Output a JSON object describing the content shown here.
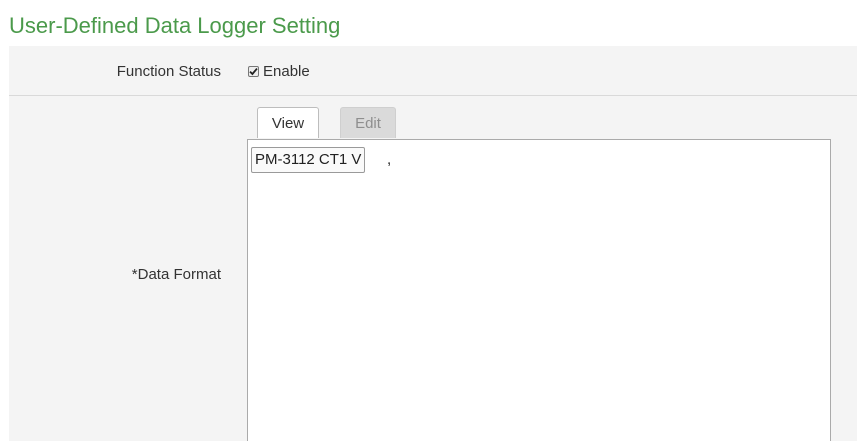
{
  "page": {
    "title": "User-Defined Data Logger Setting"
  },
  "function_status": {
    "label": "Function Status",
    "checkbox_label": "Enable",
    "checked": true
  },
  "data_format": {
    "label": "*Data Format",
    "tabs": [
      {
        "label": "View",
        "active": true
      },
      {
        "label": "Edit",
        "active": false
      }
    ],
    "tokens": [
      "PM-3112 CT1 V"
    ],
    "separator": ","
  }
}
